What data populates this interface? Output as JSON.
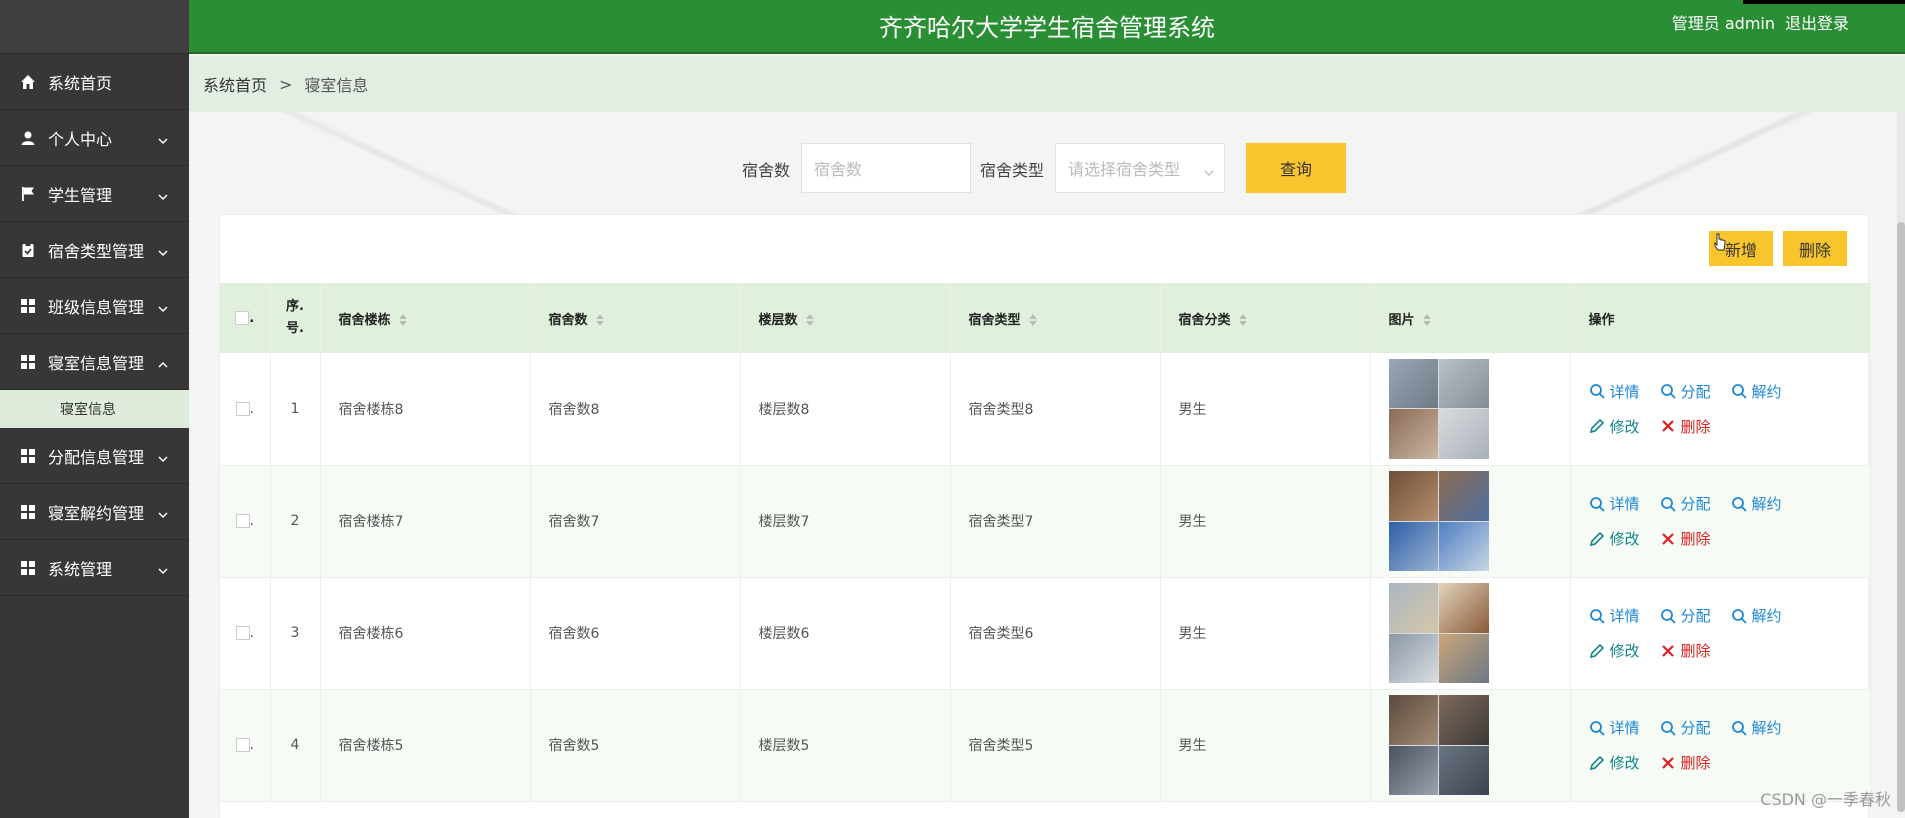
{
  "app": {
    "title": "齐齐哈尔大学学生宿舍管理系统",
    "user": "管理员 admin",
    "logout": "退出登录"
  },
  "sidebar": {
    "items": [
      {
        "label": "系统首页",
        "icon": "home-icon",
        "expandable": false
      },
      {
        "label": "个人中心",
        "icon": "user-icon",
        "expandable": true
      },
      {
        "label": "学生管理",
        "icon": "flag-icon",
        "expandable": true
      },
      {
        "label": "宿舍类型管理",
        "icon": "clipboard-icon",
        "expandable": true
      },
      {
        "label": "班级信息管理",
        "icon": "grid-icon",
        "expandable": true
      },
      {
        "label": "寝室信息管理",
        "icon": "grid-icon",
        "expandable": true,
        "open": true
      },
      {
        "label": "分配信息管理",
        "icon": "grid-icon",
        "expandable": true
      },
      {
        "label": "寝室解约管理",
        "icon": "grid-icon",
        "expandable": true
      },
      {
        "label": "系统管理",
        "icon": "grid-icon",
        "expandable": true
      }
    ],
    "sub_item": "寝室信息"
  },
  "breadcrumb": {
    "home": "系统首页",
    "separator": ">",
    "current": "寝室信息"
  },
  "search": {
    "field1_label": "宿舍数",
    "field1_placeholder": "宿舍数",
    "field2_label": "宿舍类型",
    "field2_placeholder": "请选择宿舍类型",
    "query_button": "查询"
  },
  "toolbar": {
    "add_label": "新增",
    "delete_label": "删除"
  },
  "table": {
    "headers": {
      "checkbox": ".",
      "index": "序.\n号.",
      "building": "宿舍楼栋",
      "dorm_count": "宿舍数",
      "floors": "楼层数",
      "dorm_type": "宿舍类型",
      "category": "宿舍分类",
      "image": "图片",
      "ops": "操作"
    },
    "rows": [
      {
        "index": "1",
        "building": "宿舍楼栋8",
        "dorm_count": "宿舍数8",
        "floors": "楼层数8",
        "dorm_type": "宿舍类型8",
        "category": "男生"
      },
      {
        "index": "2",
        "building": "宿舍楼栋7",
        "dorm_count": "宿舍数7",
        "floors": "楼层数7",
        "dorm_type": "宿舍类型7",
        "category": "男生"
      },
      {
        "index": "3",
        "building": "宿舍楼栋6",
        "dorm_count": "宿舍数6",
        "floors": "楼层数6",
        "dorm_type": "宿舍类型6",
        "category": "男生"
      },
      {
        "index": "4",
        "building": "宿舍楼栋5",
        "dorm_count": "宿舍数5",
        "floors": "楼层数5",
        "dorm_type": "宿舍类型5",
        "category": "男生"
      }
    ],
    "ops": {
      "detail": "详情",
      "assign": "分配",
      "cancel": "解约",
      "edit": "修改",
      "delete": "删除"
    }
  },
  "colors": {
    "header_green": "#2a8f34",
    "sidebar_dark": "#373737",
    "accent_yellow": "#f8c52c",
    "table_header_bg": "#e0f0dc",
    "link_blue": "#1e88d6",
    "danger_red": "#d82020"
  },
  "watermark": "CSDN @一季春秋"
}
